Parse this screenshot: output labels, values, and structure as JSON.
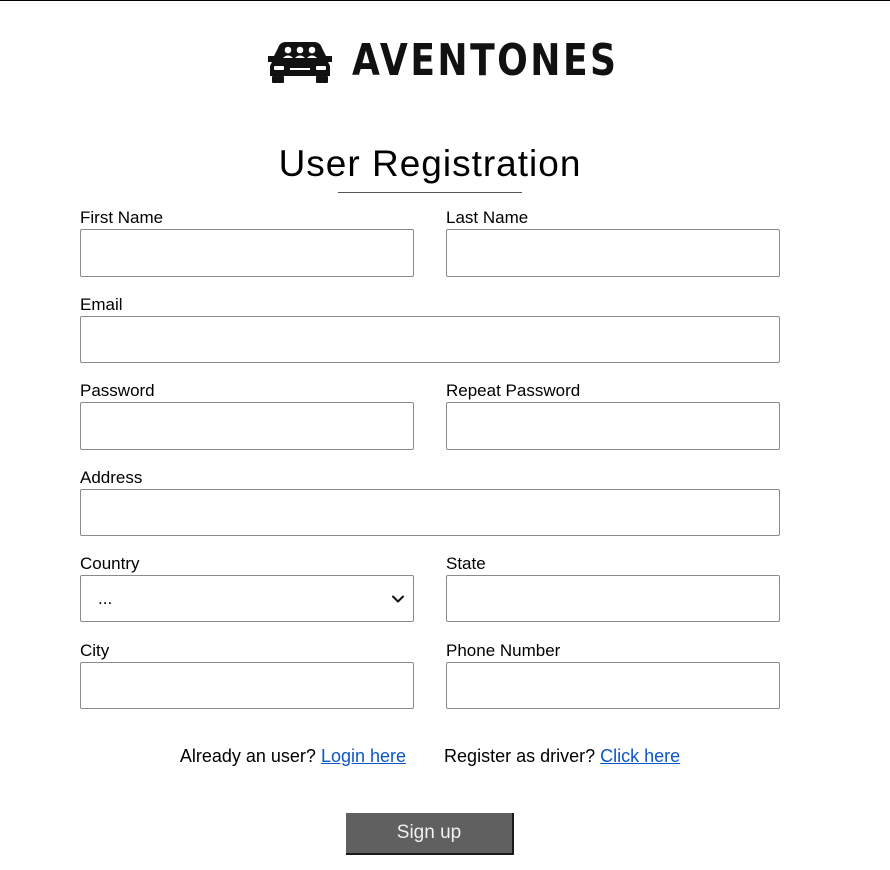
{
  "brand": {
    "name": "AVENTONES",
    "logo_icon": "car-with-passengers-icon"
  },
  "page": {
    "title": "User Registration"
  },
  "form": {
    "first_name": {
      "label": "First Name",
      "value": ""
    },
    "last_name": {
      "label": "Last Name",
      "value": ""
    },
    "email": {
      "label": "Email",
      "value": ""
    },
    "password": {
      "label": "Password",
      "value": ""
    },
    "repeat_password": {
      "label": "Repeat Password",
      "value": ""
    },
    "address": {
      "label": "Address",
      "value": ""
    },
    "country": {
      "label": "Country",
      "selected": "..."
    },
    "state": {
      "label": "State",
      "value": ""
    },
    "city": {
      "label": "City",
      "value": ""
    },
    "phone": {
      "label": "Phone Number",
      "value": ""
    }
  },
  "links": {
    "login_prompt": "Already an user?",
    "login_link": "Login here",
    "driver_prompt": "Register as driver?",
    "driver_link": "Click here"
  },
  "actions": {
    "signup_label": "Sign up"
  },
  "colors": {
    "link": "#0b57c4",
    "button_bg": "#606060",
    "button_text": "#f0f0f0",
    "input_border": "#8a8a8a"
  }
}
